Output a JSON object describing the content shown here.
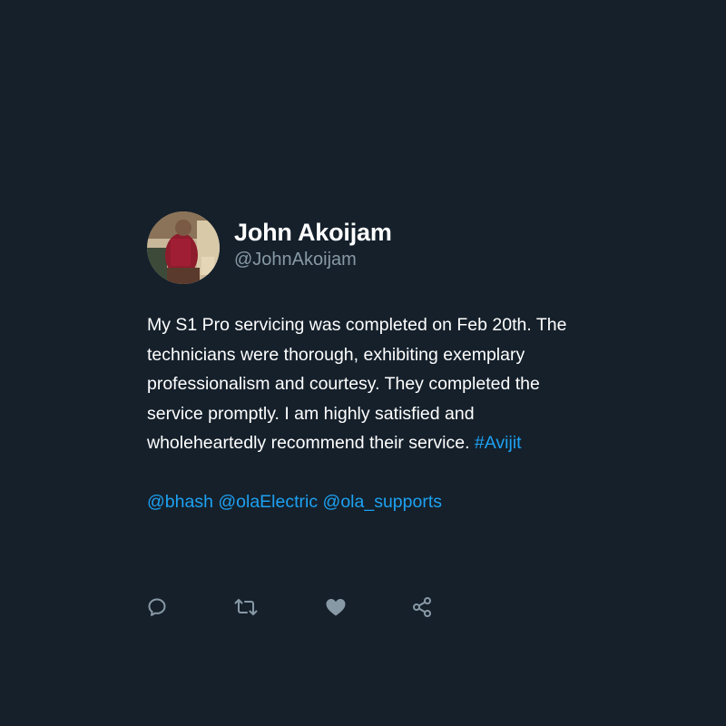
{
  "user": {
    "display_name": "John Akoijam",
    "handle": "@JohnAkoijam",
    "avatar_icon": "avatar-photo"
  },
  "tweet": {
    "text": "My S1 Pro servicing was completed on Feb 20th. The technicians were thorough, exhibiting exemplary professionalism and courtesy. They completed the service promptly. I am highly satisfied and wholeheartedly recommend their service.",
    "hashtag": "#Avijit",
    "mentions": [
      "@bhash",
      "@olaElectric",
      "@ola_supports"
    ]
  },
  "actions": [
    {
      "name": "reply",
      "icon": "reply-icon"
    },
    {
      "name": "retweet",
      "icon": "retweet-icon"
    },
    {
      "name": "like",
      "icon": "heart-icon"
    },
    {
      "name": "share",
      "icon": "share-icon"
    }
  ],
  "colors": {
    "background": "#15202b",
    "text": "#ffffff",
    "secondary_text": "#8899a6",
    "link": "#1da1f2",
    "icon": "#8899a6"
  }
}
